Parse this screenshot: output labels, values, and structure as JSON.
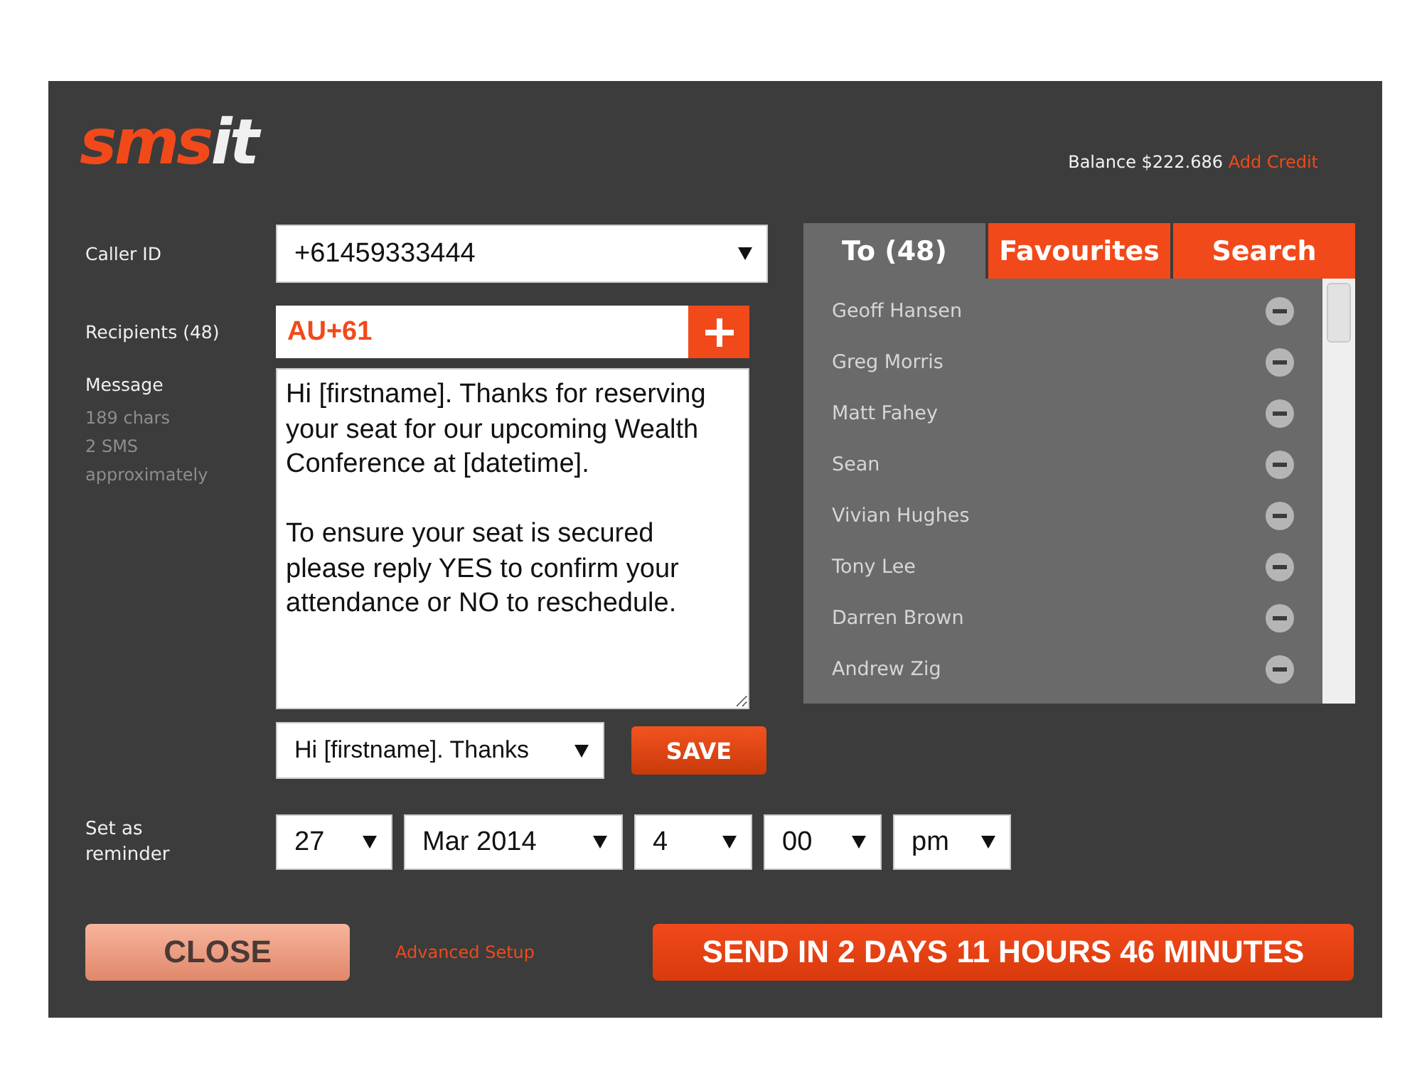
{
  "logo": {
    "part_1": "sms",
    "part_2": "it"
  },
  "balance": {
    "label": "Balance $222.686",
    "link": "Add Credit"
  },
  "caller_id": {
    "label": "Caller ID",
    "value": "+61459333444"
  },
  "recipients": {
    "label": "Recipients (48)",
    "value": "AU+61"
  },
  "message": {
    "label": "Message",
    "stats": [
      "189 chars",
      "2 SMS",
      "approximately"
    ],
    "text": "Hi [firstname]. Thanks for reserving your seat for our upcoming Wealth Conference at [datetime].\n\nTo ensure your seat is secured please reply YES to confirm your attendance or NO to reschedule.",
    "template": "Hi [firstname]. Thanks",
    "save": "SAVE"
  },
  "reminder": {
    "label": "Set as reminder",
    "fields": [
      "27",
      "Mar 2014",
      "4",
      "00",
      "pm"
    ]
  },
  "tabs": [
    {
      "label": "To (48)",
      "selected": true
    },
    {
      "label": "Favourites",
      "selected": false
    },
    {
      "label": "Search",
      "selected": false
    }
  ],
  "contacts": [
    "Geoff Hansen",
    "Greg Morris",
    "Matt Fahey",
    "Sean",
    "Vivian Hughes",
    "Tony Lee",
    "Darren Brown",
    "Andrew Zig"
  ],
  "close": "CLOSE",
  "advanced": "Advanced Setup",
  "send": "SEND IN 2 DAYS 11 HOURS 46 MINUTES"
}
